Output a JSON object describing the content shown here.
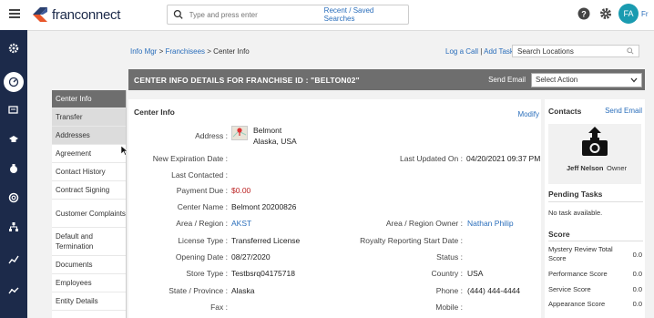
{
  "header": {
    "logo_text": "franconnect",
    "search_placeholder": "Type and press enter",
    "search_link": "Recent / Saved Searches",
    "avatar_initials": "FA",
    "user_name_partial": "Fr"
  },
  "breadcrumb": {
    "info_mgr": "Info Mgr",
    "sep1": " > ",
    "franchisees": "Franchisees",
    "sep2": " > ",
    "current": "Center Info"
  },
  "top_links": {
    "log_call": "Log a Call",
    "sep": " | ",
    "add_task": "Add Task",
    "location_search_placeholder": "Search Locations"
  },
  "titlebar": {
    "title": "CENTER INFO DETAILS FOR FRANCHISE ID : \"BELTON02\"",
    "send_email": "Send Email",
    "action_select": "Select Action"
  },
  "side_menu": [
    {
      "label": "Center Info"
    },
    {
      "label": "Transfer"
    },
    {
      "label": "Addresses"
    },
    {
      "label": "Agreement"
    },
    {
      "label": "Contact History"
    },
    {
      "label": "Contract Signing"
    },
    {
      "label": "Customer Complaints"
    },
    {
      "label": "Default and Termination"
    },
    {
      "label": "Documents"
    },
    {
      "label": "Employees"
    },
    {
      "label": "Entity Details"
    }
  ],
  "center_info": {
    "title": "Center Info",
    "modify": "Modify",
    "address_label": "Address :",
    "address_line1": "Belmont",
    "address_line2": "Alaska, USA",
    "new_expiration_label": "New Expiration Date :",
    "new_expiration_value": "",
    "last_updated_label": "Last Updated On :",
    "last_updated_value": "04/20/2021 09:37 PM",
    "last_contacted_label": "Last Contacted :",
    "last_contacted_value": "",
    "payment_due_label": "Payment Due :",
    "payment_due_value": "$0.00",
    "center_name_label": "Center Name :",
    "center_name_value": "Belmont 20200826",
    "area_region_label": "Area / Region :",
    "area_region_value": "AKST",
    "area_owner_label": "Area / Region Owner :",
    "area_owner_value": "Nathan Philip",
    "license_type_label": "License Type :",
    "license_type_value": "Transferred License",
    "royalty_label": "Royalty Reporting Start Date :",
    "royalty_value": "",
    "opening_date_label": "Opening Date :",
    "opening_date_value": "08/27/2020",
    "status_label": "Status :",
    "status_value": "",
    "store_type_label": "Store Type :",
    "store_type_value": "Testbsrq04175718",
    "country_label": "Country :",
    "country_value": "USA",
    "state_label": "State / Province :",
    "state_value": "Alaska",
    "phone_label": "Phone :",
    "phone_value": "(444) 444-4444",
    "fax_label": "Fax :",
    "fax_value": "",
    "mobile_label": "Mobile :",
    "mobile_value": ""
  },
  "contacts": {
    "title": "Contacts",
    "send_email": "Send Email",
    "contact_name": "Jeff Nelson",
    "contact_role": "Owner",
    "pending_title": "Pending Tasks",
    "pending_text": "No task available.",
    "score_title": "Score",
    "scores": [
      {
        "label": "Mystery Review Total Score",
        "value": "0.0"
      },
      {
        "label": "Performance Score",
        "value": "0.0"
      },
      {
        "label": "Service Score",
        "value": "0.0"
      },
      {
        "label": "Appearance Score",
        "value": "0.0"
      }
    ]
  },
  "colors": {
    "nav_bg": "#1c2a4a",
    "accent": "#2a6ebb",
    "title_bar": "#6e6e6e",
    "avatar": "#1a9bb0"
  }
}
